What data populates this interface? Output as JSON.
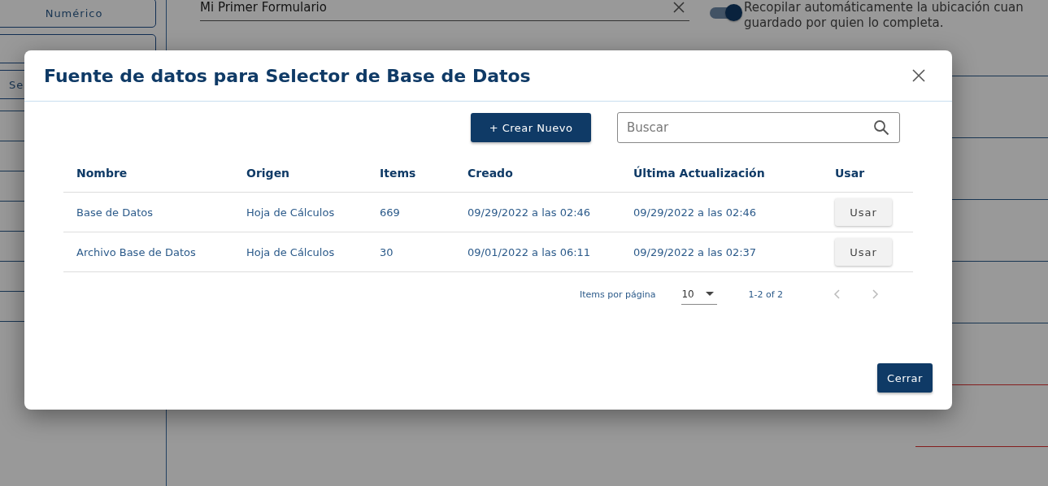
{
  "background": {
    "sidebar_buttons": [
      {
        "kind": "labelled",
        "label": "Numérico"
      },
      {
        "kind": "covered"
      },
      {
        "kind": "labelled",
        "label": "Se"
      }
    ],
    "form_name": {
      "value": "Mi Primer Formulario"
    },
    "location_toggle": {
      "on": true,
      "label_lines": [
        "Recopilar automáticamente la ubicación cuan",
        "guardado por quien lo completa."
      ]
    }
  },
  "dialog": {
    "title": "Fuente de datos para Selector de Base de Datos",
    "create_button": "+ Crear Nuevo",
    "search": {
      "placeholder": "Buscar"
    },
    "table": {
      "columns": [
        "Nombre",
        "Origen",
        "Items",
        "Creado",
        "Última Actualización",
        "Usar"
      ],
      "rows": [
        {
          "cells": [
            "Base de Datos",
            "Hoja de Cálculos",
            "669",
            "09/29/2022 a las 02:46",
            "09/29/2022 a las 02:46"
          ],
          "action": "Usar"
        },
        {
          "cells": [
            "Archivo Base de Datos",
            "Hoja de Cálculos",
            "30",
            "09/01/2022 a las 06:11",
            "09/29/2022 a las 02:37"
          ],
          "action": "Usar"
        }
      ]
    },
    "pagination": {
      "label": "Items por página",
      "page_size": "10",
      "range": "1-2 of 2",
      "prev_disabled": true,
      "next_disabled": true
    },
    "close_button": "Cerrar"
  }
}
